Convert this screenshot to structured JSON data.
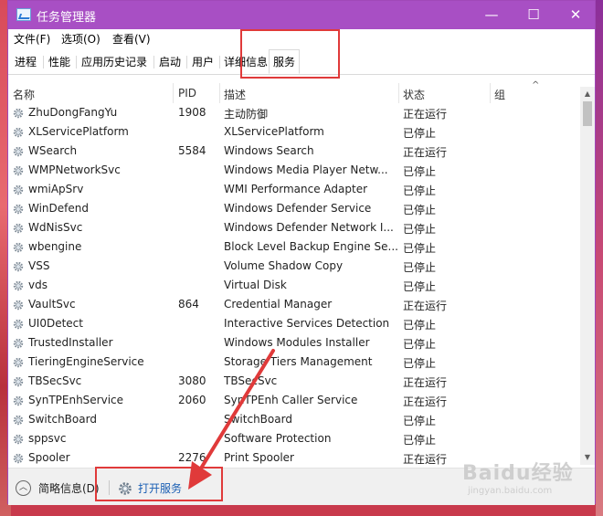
{
  "window": {
    "title": "任务管理器"
  },
  "controls": {
    "minimize": "—",
    "maximize": "☐",
    "close": "✕"
  },
  "menu": [
    "文件(F)",
    "选项(O)",
    "查看(V)"
  ],
  "tabs": [
    "进程",
    "性能",
    "应用历史记录",
    "启动",
    "用户",
    "详细信息",
    "服务"
  ],
  "active_tab": "服务",
  "columns": {
    "name": "名称",
    "pid": "PID",
    "desc": "描述",
    "status": "状态",
    "group": "组"
  },
  "services": [
    {
      "name": "ZhuDongFangYu",
      "pid": "1908",
      "desc": "主动防御",
      "status": "正在运行"
    },
    {
      "name": "XLServicePlatform",
      "pid": "",
      "desc": "XLServicePlatform",
      "status": "已停止"
    },
    {
      "name": "WSearch",
      "pid": "5584",
      "desc": "Windows Search",
      "status": "正在运行"
    },
    {
      "name": "WMPNetworkSvc",
      "pid": "",
      "desc": "Windows Media Player Netw...",
      "status": "已停止"
    },
    {
      "name": "wmiApSrv",
      "pid": "",
      "desc": "WMI Performance Adapter",
      "status": "已停止"
    },
    {
      "name": "WinDefend",
      "pid": "",
      "desc": "Windows Defender Service",
      "status": "已停止"
    },
    {
      "name": "WdNisSvc",
      "pid": "",
      "desc": "Windows Defender Network I...",
      "status": "已停止"
    },
    {
      "name": "wbengine",
      "pid": "",
      "desc": "Block Level Backup Engine Se...",
      "status": "已停止"
    },
    {
      "name": "VSS",
      "pid": "",
      "desc": "Volume Shadow Copy",
      "status": "已停止"
    },
    {
      "name": "vds",
      "pid": "",
      "desc": "Virtual Disk",
      "status": "已停止"
    },
    {
      "name": "VaultSvc",
      "pid": "864",
      "desc": "Credential Manager",
      "status": "正在运行"
    },
    {
      "name": "UI0Detect",
      "pid": "",
      "desc": "Interactive Services Detection",
      "status": "已停止"
    },
    {
      "name": "TrustedInstaller",
      "pid": "",
      "desc": "Windows Modules Installer",
      "status": "已停止"
    },
    {
      "name": "TieringEngineService",
      "pid": "",
      "desc": "Storage Tiers Management",
      "status": "已停止"
    },
    {
      "name": "TBSecSvc",
      "pid": "3080",
      "desc": "TBSecSvc",
      "status": "正在运行"
    },
    {
      "name": "SynTPEnhService",
      "pid": "2060",
      "desc": "SynTPEnh Caller Service",
      "status": "正在运行"
    },
    {
      "name": "SwitchBoard",
      "pid": "",
      "desc": "SwitchBoard",
      "status": "已停止"
    },
    {
      "name": "sppsvc",
      "pid": "",
      "desc": "Software Protection",
      "status": "已停止"
    },
    {
      "name": "Spooler",
      "pid": "2276",
      "desc": "Print Spooler",
      "status": "正在运行"
    }
  ],
  "footer": {
    "fewer_details": "简略信息(D)",
    "open_services": "打开服务"
  },
  "watermark": {
    "main": "Baidu经验",
    "sub": "jingyan.baidu.com"
  },
  "colors": {
    "titlebar": "#a84fc4",
    "highlight": "#e03a3a",
    "link": "#1a5fb4"
  }
}
